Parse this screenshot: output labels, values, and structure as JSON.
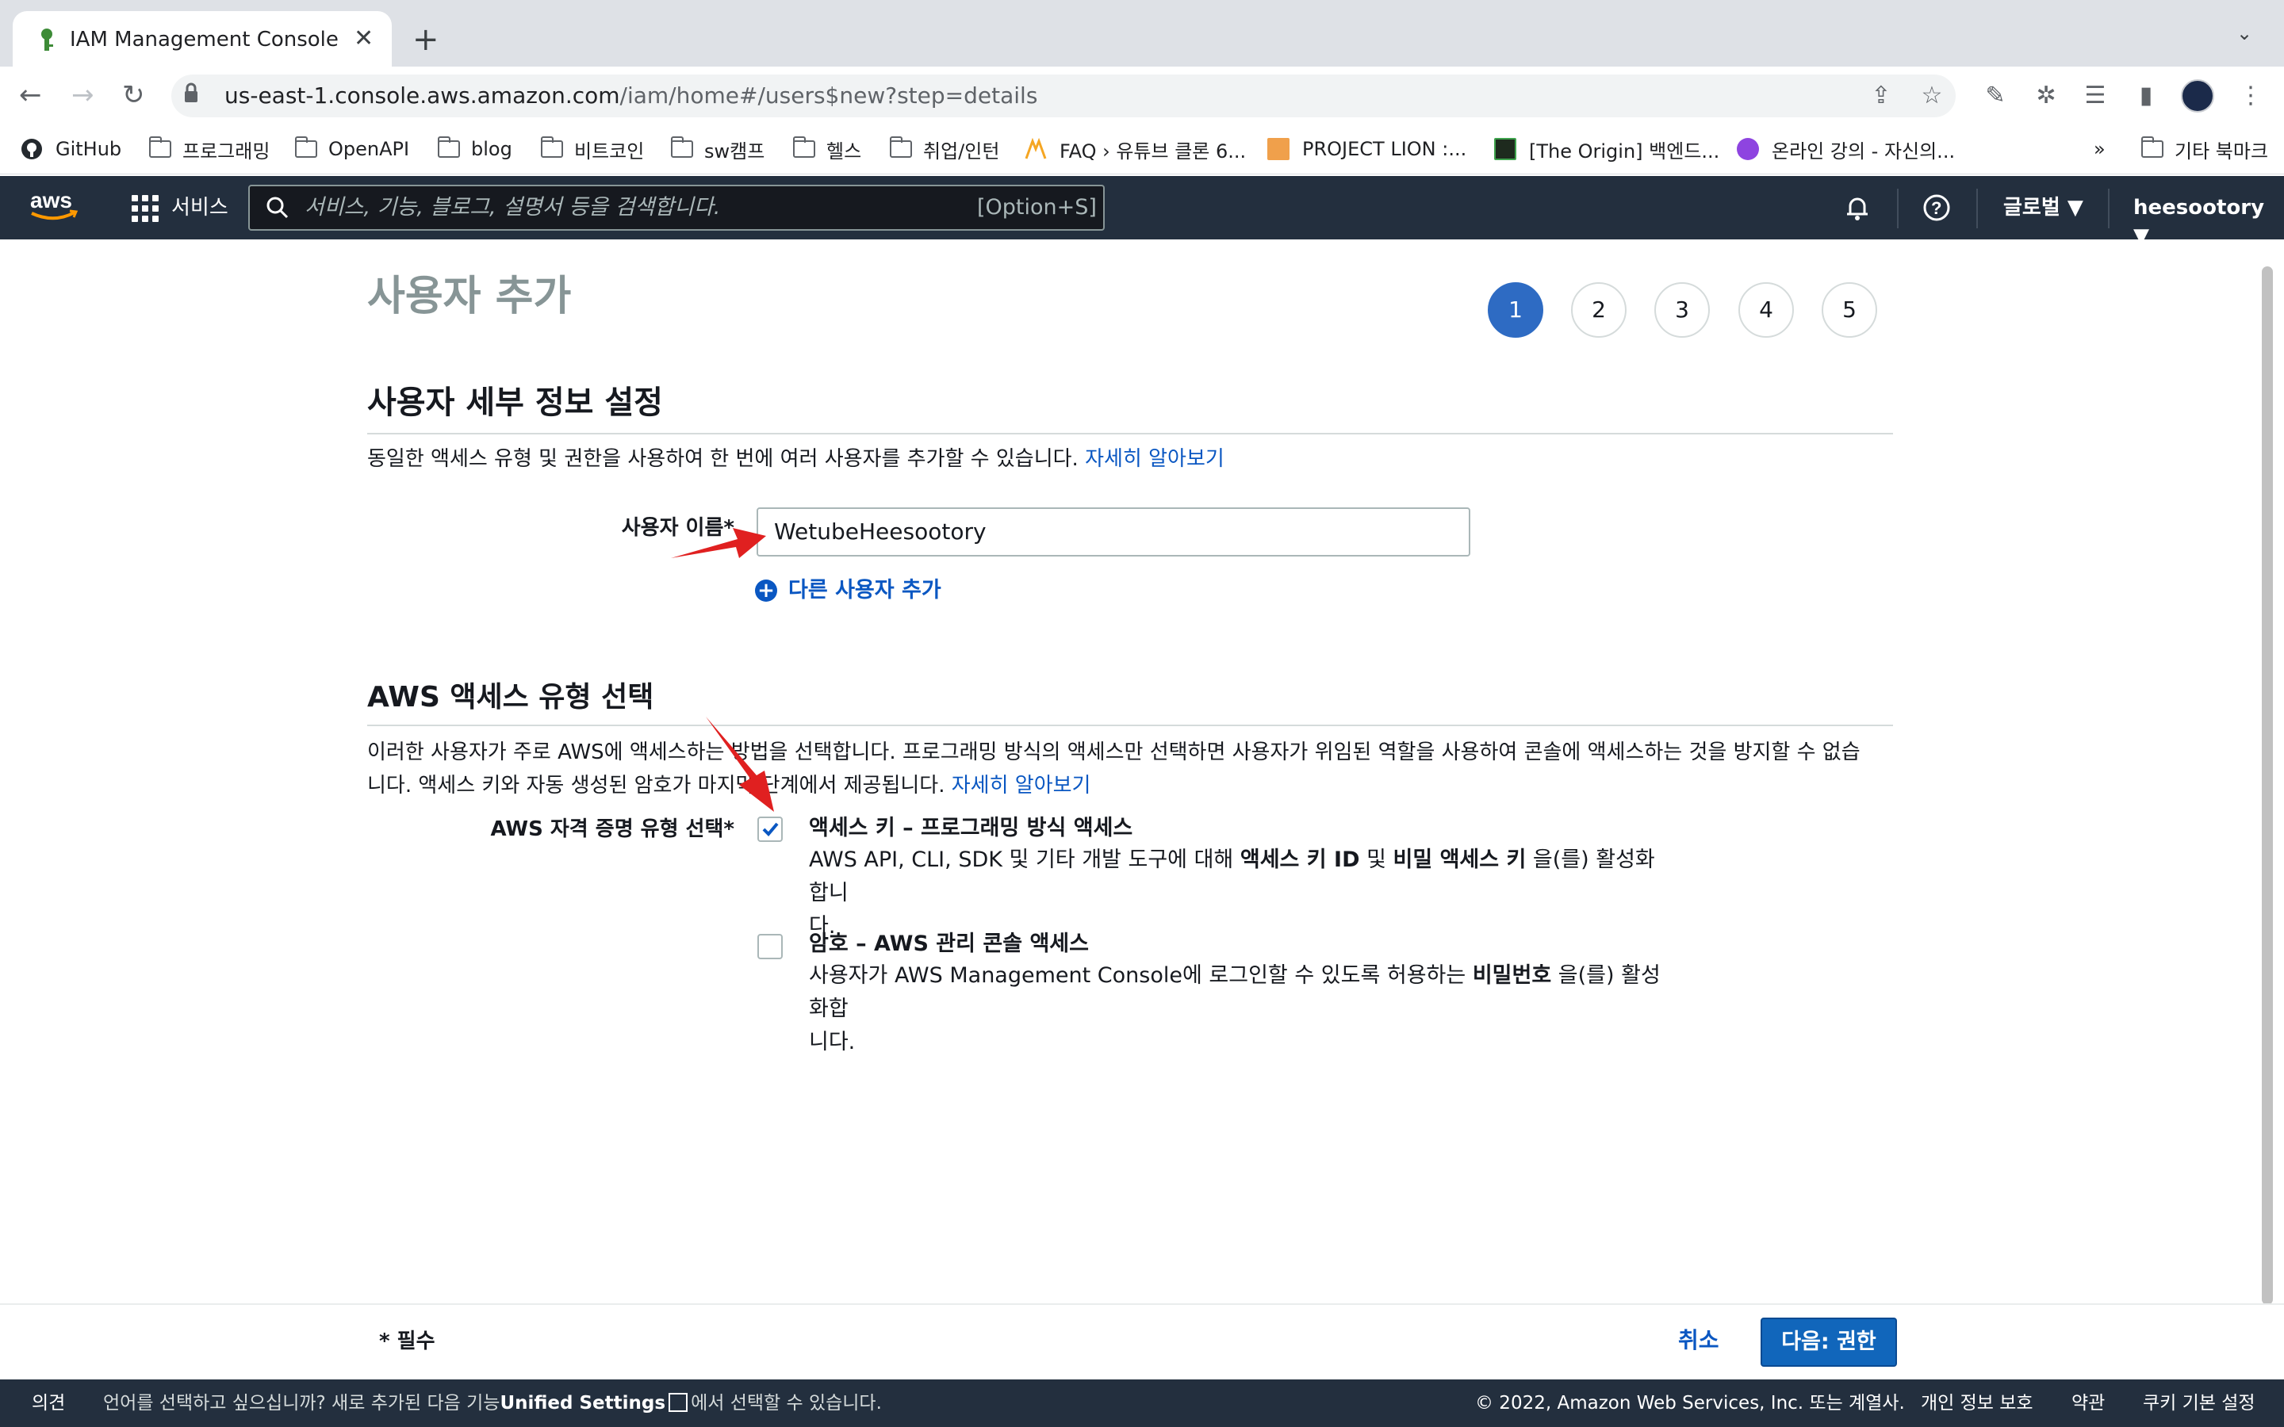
{
  "browser": {
    "tab_title": "IAM Management Console",
    "url_host": "us-east-1.console.aws.amazon.com",
    "url_path": "/iam/home#/users$new?step=details",
    "bookmarks": [
      "GitHub",
      "프로그래밍",
      "OpenAPI",
      "blog",
      "비트코인",
      "sw캠프",
      "헬스",
      "취업/인턴",
      "FAQ › 유튜브 클론 6...",
      "PROJECT LION :...",
      "[The Origin] 백엔드...",
      "온라인 강의 - 자신의..."
    ],
    "bookmarks_more": "»",
    "other_bookmarks": "기타 북마크"
  },
  "aws_nav": {
    "services": "서비스",
    "search_placeholder": "서비스, 기능, 블로그, 설명서 등을 검색합니다.",
    "search_shortcut": "[Option+S]",
    "region": "글로벌",
    "account": "heesootory"
  },
  "page": {
    "title": "사용자 추가",
    "steps": [
      "1",
      "2",
      "3",
      "4",
      "5"
    ],
    "active_step": 1,
    "details_heading": "사용자 세부 정보 설정",
    "details_desc": "동일한 액세스 유형 및 권한을 사용하여 한 번에 여러 사용자를 추가할 수 있습니다.",
    "learn_more": "자세히 알아보기",
    "username_label": "사용자 이름*",
    "username_value": "WetubeHeesootory",
    "add_user_link": "다른 사용자 추가",
    "access_heading": "AWS 액세스 유형 선택",
    "access_desc_line1": "이러한 사용자가 주로 AWS에 액세스하는 방법을 선택합니다. 프로그래밍 방식의 액세스만 선택하면 사용자가 위임된 역할을 사용하여 콘솔에 액세스하는 것을 방지할 수 없습",
    "access_desc_line2": "니다. 액세스 키와 자동 생성된 암호가 마지막 단계에서 제공됩니다.",
    "credential_label": "AWS 자격 증명 유형 선택*",
    "option1": {
      "checked": true,
      "title": "액세스 키 – 프로그래밍 방식 액세스",
      "desc_a": "AWS API, CLI, SDK 및 기타 개발 도구에 대해 ",
      "desc_b": "액세스 키 ID",
      "desc_c": " 및 ",
      "desc_d": "비밀 액세스 키",
      "desc_e": " 을(를) 활성화합니",
      "desc_f": "다."
    },
    "option2": {
      "checked": false,
      "title": "암호 – AWS 관리 콘솔 액세스",
      "desc_a": "사용자가 AWS Management Console에 로그인할 수 있도록 허용하는 ",
      "desc_b": "비밀번호",
      "desc_c": " 을(를) 활성화합",
      "desc_d": "니다."
    }
  },
  "footer": {
    "required": "* 필수",
    "cancel": "취소",
    "next": "다음: 권한"
  },
  "console_footer": {
    "feedback": "의견",
    "lang_a": "언어를 선택하고 싶으십니까? 새로 추가된 다음 기능",
    "lang_b": "Unified Settings",
    "lang_c": "에서 선택할 수 있습니다.",
    "copyright": "© 2022, Amazon Web Services, Inc. 또는 계열사.",
    "privacy": "개인 정보 보호",
    "terms": "약관",
    "cookies": "쿠키 기본 설정"
  },
  "colors": {
    "aws_nav": "#232f3e",
    "link": "#0a57c2",
    "primary_button": "#1166bb",
    "annotation_arrow": "#e02020"
  }
}
